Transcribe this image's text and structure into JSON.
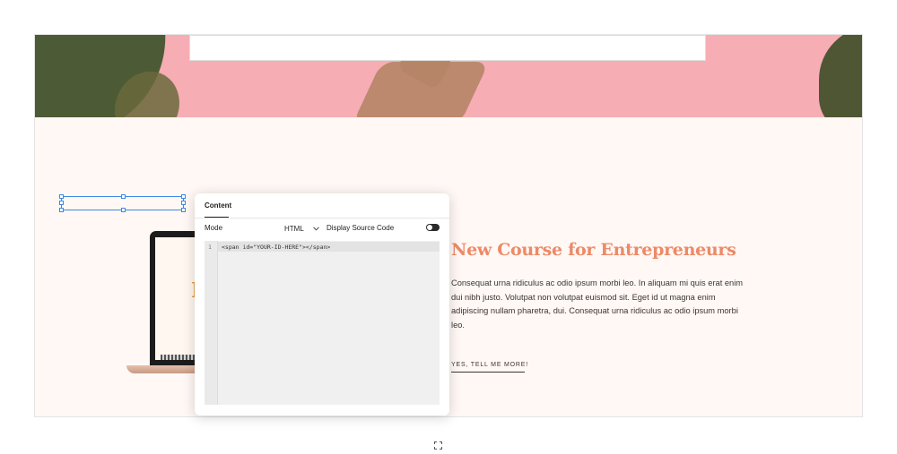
{
  "panel": {
    "tab_label": "Content",
    "mode_label": "Mode",
    "mode_value": "HTML",
    "source_label": "Display Source Code",
    "toggle_on": true
  },
  "editor": {
    "line_number": "1",
    "code": "<span id=\"YOUR-ID-HERE\"></span>"
  },
  "content": {
    "laptop_letter": "F",
    "headline": "New Course for Entrepreneurs",
    "body": "Consequat urna ridiculus ac odio ipsum morbi leo. In aliquam mi quis erat enim dui nibh justo. Volutpat non volutpat euismod sit. Eget id ut magna enim adipiscing nullam pharetra, dui. Consequat urna ridiculus ac odio ipsum morbi leo.",
    "cta": "YES, TELL ME MORE!"
  },
  "colors": {
    "hero_pink": "#f7adb4",
    "headline": "#ec8a67",
    "selection": "#3e88e6",
    "page_bg": "#fff8f5"
  },
  "icons": {
    "chevron": "chevron-down-icon",
    "expand": "expand-icon"
  }
}
